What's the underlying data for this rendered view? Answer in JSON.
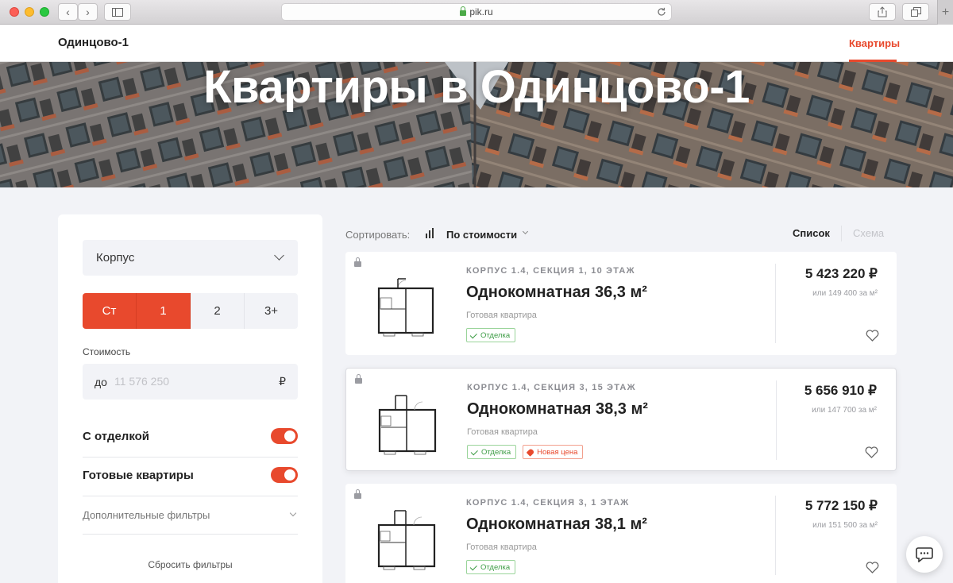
{
  "browser": {
    "url": "pik.ru",
    "buttons": {
      "back": "‹",
      "forward": "›",
      "plus": "+"
    }
  },
  "header": {
    "site_title": "Одинцово-1",
    "nav_active": "Квартиры"
  },
  "hero": {
    "title": "Квартиры в Одинцово-1"
  },
  "filters": {
    "building_select": "Корпус",
    "rooms": [
      "Ст",
      "1",
      "2",
      "3+"
    ],
    "rooms_active": [
      "Ст",
      "1"
    ],
    "price_label": "Стоимость",
    "price_prefix": "до",
    "price_placeholder": "11 576 250",
    "currency": "₽",
    "toggle_finish": "С отделкой",
    "toggle_ready": "Готовые квартиры",
    "toggles_on": [
      true,
      true
    ],
    "more_filters": "Дополнительные фильтры",
    "reset": "Сбросить фильтры"
  },
  "sort": {
    "label": "Сортировать:",
    "value": "По стоимости",
    "view_list": "Список",
    "view_scheme": "Схема"
  },
  "listings": [
    {
      "location": "КОРПУС 1.4, СЕКЦИЯ 1, 10 ЭТАЖ",
      "name": "Однокомнатная 36,3 м²",
      "status": "Готовая квартира",
      "badge_finish": "Отделка",
      "price": "5 423 220 ₽",
      "price_per_m2": "или 149 400 за м²"
    },
    {
      "location": "КОРПУС 1.4, СЕКЦИЯ 3, 15 ЭТАЖ",
      "name": "Однокомнатная 38,3 м²",
      "status": "Готовая квартира",
      "badge_finish": "Отделка",
      "badge_new_price": "Новая цена",
      "price": "5 656 910 ₽",
      "price_per_m2": "или 147 700 за м²"
    },
    {
      "location": "КОРПУС 1.4, СЕКЦИЯ 3, 1 ЭТАЖ",
      "name": "Однокомнатная 38,1 м²",
      "status": "Готовая квартира",
      "badge_finish": "Отделка",
      "price": "5 772 150 ₽",
      "price_per_m2": "или 151 500 за м²"
    }
  ],
  "colors": {
    "accent": "#e8492d",
    "badge_green": "#3d9c45",
    "page_bg": "#f2f3f7"
  },
  "icons": [
    "lock-icon",
    "sidebar-icon",
    "share-icon",
    "tabs-icon",
    "reload-icon",
    "chevron-down-icon",
    "sort-bars-icon",
    "check-icon",
    "tag-icon",
    "heart-icon",
    "chat-icon"
  ]
}
